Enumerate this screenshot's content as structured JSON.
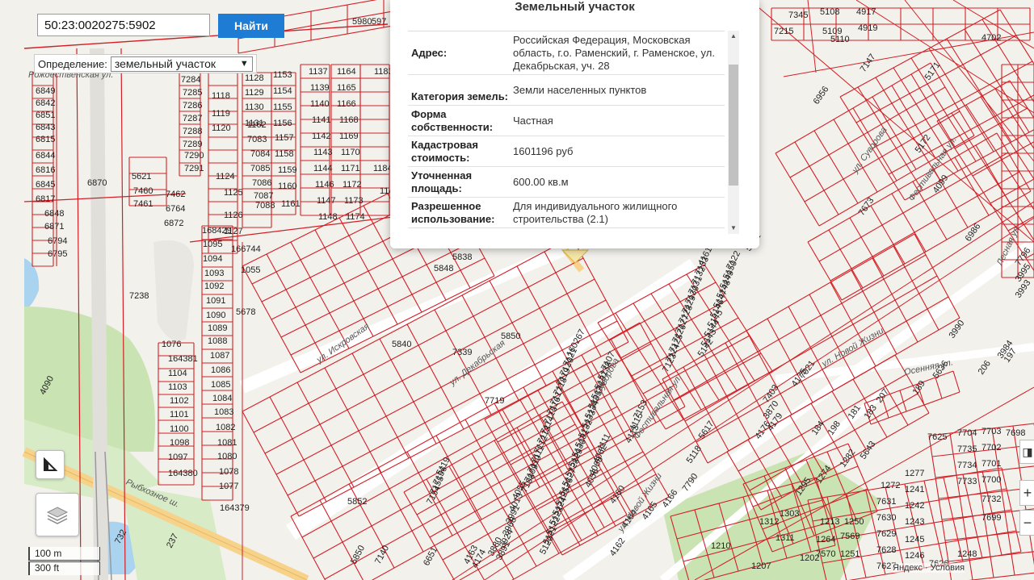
{
  "search": {
    "value": "50:23:0020275:5902",
    "button_label": "Найти"
  },
  "definition": {
    "label": "Определение:",
    "selected": "земельный участок"
  },
  "popup": {
    "title": "Земельный участок",
    "rows": [
      {
        "key": "Адрес:",
        "value": "Российская Федерация, Московская область, г.о. Раменский, г. Раменское, ул. Декабрьская, уч. 28"
      },
      {
        "key": "Категория земель:",
        "value": "Земли населенных пунктов"
      },
      {
        "key": "Форма собственности:",
        "value": "Частная"
      },
      {
        "key": "Кадастровая стоимость:",
        "value": "1601196 руб"
      },
      {
        "key": "Уточненная площадь:",
        "value": "600.00 кв.м"
      },
      {
        "key": "Разрешенное использование:",
        "value": "Для индивидуального жилищного строительства (2.1)"
      }
    ]
  },
  "scale": {
    "metric": "100 m",
    "imperial": "300 ft"
  },
  "attribution": "Яндекс · Условия",
  "colors": {
    "parcel": "#d21f26",
    "road": "#f6d28a",
    "green": "#c9e3b3",
    "water": "#a9d3ee"
  },
  "parcels": [
    {
      "label": "5980"
    },
    {
      "label": "597"
    },
    {
      "label": "7345"
    },
    {
      "label": "5108"
    },
    {
      "label": "4917"
    },
    {
      "label": "7215"
    },
    {
      "label": "5109"
    },
    {
      "label": "4919"
    },
    {
      "label": "5110"
    },
    {
      "label": "4702"
    },
    {
      "label": "6849"
    },
    {
      "label": "6842"
    },
    {
      "label": "6851"
    },
    {
      "label": "6843"
    },
    {
      "label": "6815"
    },
    {
      "label": "6844"
    },
    {
      "label": "6816"
    },
    {
      "label": "6845"
    },
    {
      "label": "6817"
    },
    {
      "label": "6848"
    },
    {
      "label": "6871"
    },
    {
      "label": "6794"
    },
    {
      "label": "6795"
    },
    {
      "label": "7284"
    },
    {
      "label": "7285"
    },
    {
      "label": "7286"
    },
    {
      "label": "7287"
    },
    {
      "label": "7288"
    },
    {
      "label": "7289"
    },
    {
      "label": "7290"
    },
    {
      "label": "7291"
    },
    {
      "label": "1118"
    },
    {
      "label": "1119"
    },
    {
      "label": "1120"
    },
    {
      "label": "1124"
    },
    {
      "label": "1125"
    },
    {
      "label": "1126"
    },
    {
      "label": "1127"
    },
    {
      "label": "1128"
    },
    {
      "label": "1129"
    },
    {
      "label": "1130"
    },
    {
      "label": "1131"
    },
    {
      "label": "1153"
    },
    {
      "label": "1154"
    },
    {
      "label": "1155"
    },
    {
      "label": "1156"
    },
    {
      "label": "1157"
    },
    {
      "label": "1158"
    },
    {
      "label": "1159"
    },
    {
      "label": "1160"
    },
    {
      "label": "1161"
    },
    {
      "label": "1162"
    },
    {
      "label": "7083"
    },
    {
      "label": "7084"
    },
    {
      "label": "7085"
    },
    {
      "label": "7086"
    },
    {
      "label": "7087"
    },
    {
      "label": "7088"
    },
    {
      "label": "1137"
    },
    {
      "label": "1164"
    },
    {
      "label": "1139"
    },
    {
      "label": "1165"
    },
    {
      "label": "1140"
    },
    {
      "label": "1166"
    },
    {
      "label": "1141"
    },
    {
      "label": "1168"
    },
    {
      "label": "1142"
    },
    {
      "label": "1169"
    },
    {
      "label": "1143"
    },
    {
      "label": "1170"
    },
    {
      "label": "1144"
    },
    {
      "label": "1171"
    },
    {
      "label": "1146"
    },
    {
      "label": "1172"
    },
    {
      "label": "1147"
    },
    {
      "label": "1173"
    },
    {
      "label": "1148"
    },
    {
      "label": "1174"
    },
    {
      "label": "1149"
    },
    {
      "label": "1184"
    },
    {
      "label": "1183"
    },
    {
      "label": "5621"
    },
    {
      "label": "7460"
    },
    {
      "label": "7461"
    },
    {
      "label": "7462"
    },
    {
      "label": "6764"
    },
    {
      "label": "6872"
    },
    {
      "label": "6870"
    },
    {
      "label": "7238"
    },
    {
      "label": "168429"
    },
    {
      "label": "1095"
    },
    {
      "label": "1094"
    },
    {
      "label": "1093"
    },
    {
      "label": "1092"
    },
    {
      "label": "1091"
    },
    {
      "label": "1090"
    },
    {
      "label": "1089"
    },
    {
      "label": "1088"
    },
    {
      "label": "1087"
    },
    {
      "label": "1086"
    },
    {
      "label": "1085"
    },
    {
      "label": "1084"
    },
    {
      "label": "1083"
    },
    {
      "label": "1082"
    },
    {
      "label": "1081"
    },
    {
      "label": "1080"
    },
    {
      "label": "1078"
    },
    {
      "label": "1077"
    },
    {
      "label": "1076"
    },
    {
      "label": "164381"
    },
    {
      "label": "1104"
    },
    {
      "label": "1103"
    },
    {
      "label": "1102"
    },
    {
      "label": "1101"
    },
    {
      "label": "1100"
    },
    {
      "label": "1098"
    },
    {
      "label": "1097"
    },
    {
      "label": "164380"
    },
    {
      "label": "164379"
    },
    {
      "label": "166744"
    },
    {
      "label": "1055"
    },
    {
      "label": "5678"
    },
    {
      "label": "5848"
    },
    {
      "label": "5838"
    },
    {
      "label": "5840"
    },
    {
      "label": "7339"
    },
    {
      "label": "5852"
    },
    {
      "label": "5850"
    },
    {
      "label": "5850"
    },
    {
      "label": "7140"
    },
    {
      "label": "6651"
    },
    {
      "label": "4090"
    },
    {
      "label": "732"
    },
    {
      "label": "237"
    },
    {
      "label": "160267"
    },
    {
      "label": "7121"
    },
    {
      "label": "7120"
    },
    {
      "label": "7119"
    },
    {
      "label": "7118"
    },
    {
      "label": "7117"
    },
    {
      "label": "7116"
    },
    {
      "label": "7115"
    },
    {
      "label": "7114"
    },
    {
      "label": "7113"
    },
    {
      "label": "7112"
    },
    {
      "label": "7111"
    },
    {
      "label": "7110"
    },
    {
      "label": "7109"
    },
    {
      "label": "7108"
    },
    {
      "label": "7107"
    },
    {
      "label": "5138"
    },
    {
      "label": "5137"
    },
    {
      "label": "5136"
    },
    {
      "label": "5135"
    },
    {
      "label": "5134"
    },
    {
      "label": "5133"
    },
    {
      "label": "5132"
    },
    {
      "label": "5131"
    },
    {
      "label": "5130"
    },
    {
      "label": "5129"
    },
    {
      "label": "5128"
    },
    {
      "label": "5127"
    },
    {
      "label": "5126"
    },
    {
      "label": "5125"
    },
    {
      "label": "5124"
    },
    {
      "label": "5123"
    },
    {
      "label": "5122"
    },
    {
      "label": "5121"
    },
    {
      "label": "5120"
    },
    {
      "label": "5119"
    },
    {
      "label": "7156"
    },
    {
      "label": "7155"
    },
    {
      "label": "7154"
    },
    {
      "label": "7153"
    },
    {
      "label": "4115"
    },
    {
      "label": "4113"
    },
    {
      "label": "4111"
    },
    {
      "label": "4062"
    },
    {
      "label": "4068"
    },
    {
      "label": "4056"
    },
    {
      "label": "4055"
    },
    {
      "label": "4013"
    },
    {
      "label": "3991"
    },
    {
      "label": "3968"
    },
    {
      "label": "3924"
    },
    {
      "label": "3891"
    },
    {
      "label": "3880"
    },
    {
      "label": "4174"
    },
    {
      "label": "4163"
    },
    {
      "label": "4161"
    },
    {
      "label": "7133"
    },
    {
      "label": "7132"
    },
    {
      "label": "7131"
    },
    {
      "label": "7130"
    },
    {
      "label": "7129"
    },
    {
      "label": "7128"
    },
    {
      "label": "7127"
    },
    {
      "label": "7126"
    },
    {
      "label": "7125"
    },
    {
      "label": "7124"
    },
    {
      "label": "7123"
    },
    {
      "label": "7122"
    },
    {
      "label": "5150"
    },
    {
      "label": "5149"
    },
    {
      "label": "5148"
    },
    {
      "label": "5147"
    },
    {
      "label": "5146"
    },
    {
      "label": "5145"
    },
    {
      "label": "5144"
    },
    {
      "label": "5143"
    },
    {
      "label": "5142"
    },
    {
      "label": "5141"
    },
    {
      "label": "6956"
    },
    {
      "label": "7147"
    },
    {
      "label": "5171"
    },
    {
      "label": "5172"
    },
    {
      "label": "4099"
    },
    {
      "label": "6986"
    },
    {
      "label": "7673"
    },
    {
      "label": "7021"
    },
    {
      "label": "7403"
    },
    {
      "label": "3870"
    },
    {
      "label": "4179"
    },
    {
      "label": "4176"
    },
    {
      "label": "4175"
    },
    {
      "label": "7796"
    },
    {
      "label": "3995"
    },
    {
      "label": "3993"
    },
    {
      "label": "3990"
    },
    {
      "label": "3984"
    },
    {
      "label": "206"
    },
    {
      "label": "197"
    },
    {
      "label": "5636"
    },
    {
      "label": "189"
    },
    {
      "label": "207"
    },
    {
      "label": "183"
    },
    {
      "label": "181"
    },
    {
      "label": "198"
    },
    {
      "label": "184"
    },
    {
      "label": "5617"
    },
    {
      "label": "5118"
    },
    {
      "label": "7790"
    },
    {
      "label": "4166"
    },
    {
      "label": "4165"
    },
    {
      "label": "4164"
    },
    {
      "label": "4162"
    },
    {
      "label": "4160"
    },
    {
      "label": "5643"
    },
    {
      "label": "1282"
    },
    {
      "label": "1274"
    },
    {
      "label": "1295"
    },
    {
      "label": "1303"
    },
    {
      "label": "1312"
    },
    {
      "label": "1311"
    },
    {
      "label": "1202"
    },
    {
      "label": "1207"
    },
    {
      "label": "1210"
    },
    {
      "label": "1213"
    },
    {
      "label": "1250"
    },
    {
      "label": "1264"
    },
    {
      "label": "7569"
    },
    {
      "label": "7570"
    },
    {
      "label": "1251"
    },
    {
      "label": "1272"
    },
    {
      "label": "1277"
    },
    {
      "label": "7631"
    },
    {
      "label": "1241"
    },
    {
      "label": "7630"
    },
    {
      "label": "1242"
    },
    {
      "label": "7629"
    },
    {
      "label": "1243"
    },
    {
      "label": "7628"
    },
    {
      "label": "1245"
    },
    {
      "label": "7627"
    },
    {
      "label": "1246"
    },
    {
      "label": "7626"
    },
    {
      "label": "1248"
    },
    {
      "label": "7625"
    },
    {
      "label": "7704"
    },
    {
      "label": "7703"
    },
    {
      "label": "7735"
    },
    {
      "label": "7702"
    },
    {
      "label": "7734"
    },
    {
      "label": "7701"
    },
    {
      "label": "7733"
    },
    {
      "label": "7700"
    },
    {
      "label": "7732"
    },
    {
      "label": "7699"
    },
    {
      "label": "7698"
    },
    {
      "label": "7719"
    }
  ],
  "streets": [
    {
      "label": "ул. Декабрьская"
    },
    {
      "label": "ул. Искровская"
    },
    {
      "label": "Рыбхозное ш."
    },
    {
      "label": "ул. Суворова"
    },
    {
      "label": "Фестивальная ул."
    },
    {
      "label": "ул. Новой Жизни"
    },
    {
      "label": "Осенняя ул."
    },
    {
      "label": "ул. Новой Жизни"
    },
    {
      "label": "Фестивальная ул."
    },
    {
      "label": "ул. Суворова"
    },
    {
      "label": "Лесная ул."
    },
    {
      "label": "Рождественская ул."
    }
  ]
}
